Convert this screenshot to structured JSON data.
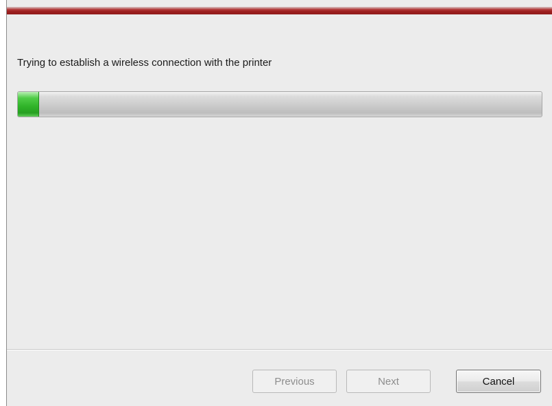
{
  "status": {
    "message": "Trying to establish a wireless connection with the printer"
  },
  "progress": {
    "fraction": 0.04,
    "fill_color": "#2fb328"
  },
  "buttons": {
    "previous_label": "Previous",
    "next_label": "Next",
    "cancel_label": "Cancel"
  },
  "colors": {
    "accent_bar": "#9d1f1f",
    "background": "#ececec"
  }
}
